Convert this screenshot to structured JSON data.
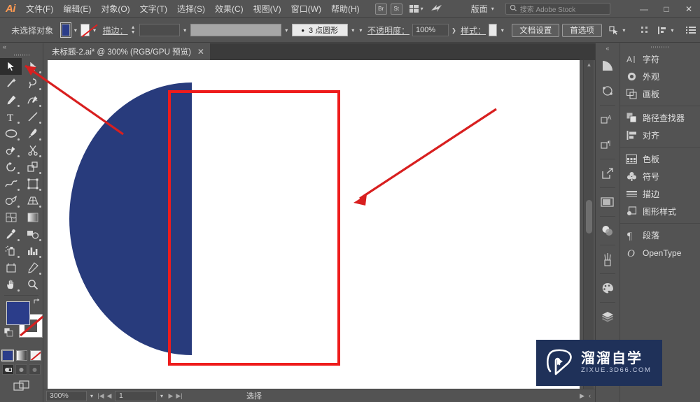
{
  "app": {
    "name": "Ai",
    "brand_color": "#ff9a52",
    "chrome_bg": "#535353"
  },
  "menubar": {
    "items": [
      {
        "label": "文件(F)",
        "name": "menu-file"
      },
      {
        "label": "编辑(E)",
        "name": "menu-edit"
      },
      {
        "label": "对象(O)",
        "name": "menu-object"
      },
      {
        "label": "文字(T)",
        "name": "menu-type"
      },
      {
        "label": "选择(S)",
        "name": "menu-select"
      },
      {
        "label": "效果(C)",
        "name": "menu-effect"
      },
      {
        "label": "视图(V)",
        "name": "menu-view"
      },
      {
        "label": "窗口(W)",
        "name": "menu-window"
      },
      {
        "label": "帮助(H)",
        "name": "menu-help"
      }
    ],
    "bridge_label": "Br",
    "stock_label": "St",
    "arrange_label": "版面",
    "search_placeholder": "搜索 Adobe Stock",
    "window_minimize": "—",
    "window_maximize": "□",
    "window_close": "✕"
  },
  "optionsbar": {
    "selection_status": "未选择对象",
    "fill_color": "#2b3d8a",
    "stroke_label": "描边：",
    "stroke_weight": "",
    "stroke_profile": "",
    "stroke_style": "3 点圆形",
    "opacity_label": "不透明度：",
    "opacity_value": "100%",
    "style_label": "样式：",
    "style_swatch": "#e9e9e9",
    "doc_setup_button": "文档设置",
    "preferences_button": "首选项"
  },
  "toolbar": {
    "tools": [
      {
        "name": "selection-tool",
        "label": "选择工具",
        "active": true
      },
      {
        "name": "direct-selection-tool",
        "label": "直接选择工具",
        "active": false
      },
      {
        "name": "magic-wand-tool",
        "label": "魔棒工具",
        "active": false
      },
      {
        "name": "lasso-tool",
        "label": "套索工具",
        "active": false
      },
      {
        "name": "pen-tool",
        "label": "钢笔工具",
        "active": false
      },
      {
        "name": "curvature-tool",
        "label": "曲率工具",
        "active": false
      },
      {
        "name": "type-tool",
        "label": "文字工具",
        "active": false
      },
      {
        "name": "line-segment-tool",
        "label": "直线段工具",
        "active": false
      },
      {
        "name": "ellipse-tool",
        "label": "椭圆工具",
        "active": false
      },
      {
        "name": "paintbrush-tool",
        "label": "画笔工具",
        "active": false
      },
      {
        "name": "pencil-tool",
        "label": "铅笔工具",
        "active": false
      },
      {
        "name": "scissors-tool",
        "label": "剪刀工具",
        "active": false
      },
      {
        "name": "rotate-tool",
        "label": "旋转工具",
        "active": false
      },
      {
        "name": "scale-tool",
        "label": "比例缩放工具",
        "active": false
      },
      {
        "name": "width-tool",
        "label": "宽度工具",
        "active": false
      },
      {
        "name": "free-transform-tool",
        "label": "自由变换工具",
        "active": false
      },
      {
        "name": "shape-builder-tool",
        "label": "形状生成器工具",
        "active": false
      },
      {
        "name": "perspective-grid-tool",
        "label": "透视网格工具",
        "active": false
      },
      {
        "name": "mesh-tool",
        "label": "网格工具",
        "active": false
      },
      {
        "name": "gradient-tool",
        "label": "渐变工具",
        "active": false
      },
      {
        "name": "eyedropper-tool",
        "label": "吸管工具",
        "active": false
      },
      {
        "name": "blend-tool",
        "label": "混合工具",
        "active": false
      },
      {
        "name": "symbol-sprayer-tool",
        "label": "符号喷枪工具",
        "active": false
      },
      {
        "name": "column-graph-tool",
        "label": "柱形图工具",
        "active": false
      },
      {
        "name": "artboard-tool",
        "label": "画板工具",
        "active": false
      },
      {
        "name": "slice-tool",
        "label": "切片工具",
        "active": false
      },
      {
        "name": "hand-tool",
        "label": "抓手工具",
        "active": false
      },
      {
        "name": "zoom-tool",
        "label": "缩放工具",
        "active": false
      }
    ],
    "fill_color": "#2b3d8a",
    "stroke_color": "none",
    "color_modes": [
      "color",
      "gradient",
      "none"
    ],
    "draw_modes": [
      "draw-normal",
      "draw-behind",
      "draw-inside"
    ],
    "screen_mode": "屏幕模式"
  },
  "document": {
    "tab_title": "未标题-2.ai* @ 300% (RGB/GPU 预览)",
    "close_glyph": "✕"
  },
  "canvas": {
    "shape": {
      "name": "half-circle",
      "fill": "#283b7c",
      "flat_edge": "right"
    },
    "annotation_rect_color": "#ee1c1c",
    "annotation_arrow_color": "#e22222"
  },
  "panel_rail": {
    "icons": [
      {
        "name": "pathfinder-rail-icon",
        "label": "路径查找器"
      },
      {
        "name": "align-rail-icon",
        "label": "对齐"
      },
      {
        "name": "character-rail-icon",
        "label": "字符"
      },
      {
        "name": "paragraph-rail-icon",
        "label": "段落"
      },
      {
        "name": "export-rail-icon",
        "label": "资源导出"
      },
      {
        "name": "artboards-rail-icon",
        "label": "画板"
      },
      {
        "name": "transparency-rail-icon",
        "label": "透明度"
      },
      {
        "name": "brushes-rail-icon",
        "label": "画笔"
      },
      {
        "name": "swatches-rail-icon",
        "label": "色板"
      },
      {
        "name": "layers-rail-icon",
        "label": "图层"
      }
    ]
  },
  "panel": {
    "groups": [
      {
        "items": [
          {
            "label": "字符",
            "icon": "character-icon",
            "name": "panel-item-character"
          },
          {
            "label": "外观",
            "icon": "appearance-icon",
            "name": "panel-item-appearance"
          },
          {
            "label": "画板",
            "icon": "artboard-icon",
            "name": "panel-item-artboard"
          }
        ]
      },
      {
        "items": [
          {
            "label": "路径查找器",
            "icon": "pathfinder-icon",
            "name": "panel-item-pathfinder"
          },
          {
            "label": "对齐",
            "icon": "align-icon",
            "name": "panel-item-align"
          }
        ]
      },
      {
        "items": [
          {
            "label": "色板",
            "icon": "swatches-icon",
            "name": "panel-item-swatches"
          },
          {
            "label": "符号",
            "icon": "symbols-icon",
            "name": "panel-item-symbols"
          },
          {
            "label": "描边",
            "icon": "stroke-icon",
            "name": "panel-item-stroke"
          },
          {
            "label": "图形样式",
            "icon": "graphic-styles-icon",
            "name": "panel-item-graphic-styles"
          }
        ]
      },
      {
        "items": [
          {
            "label": "段落",
            "icon": "paragraph-icon",
            "name": "panel-item-paragraph"
          },
          {
            "label": "OpenType",
            "icon": "opentype-icon",
            "name": "panel-item-opentype"
          }
        ]
      }
    ]
  },
  "statusbar": {
    "zoom_level": "300%",
    "page_number": "1",
    "status_text": "选择",
    "first_glyph": "|◀",
    "prev_glyph": "◀",
    "next_glyph": "▶",
    "last_glyph": "▶|"
  },
  "watermark": {
    "cn_text": "溜溜自学",
    "en_text": "ZIXUE.3D66.COM",
    "bg_color": "#1f3159"
  }
}
